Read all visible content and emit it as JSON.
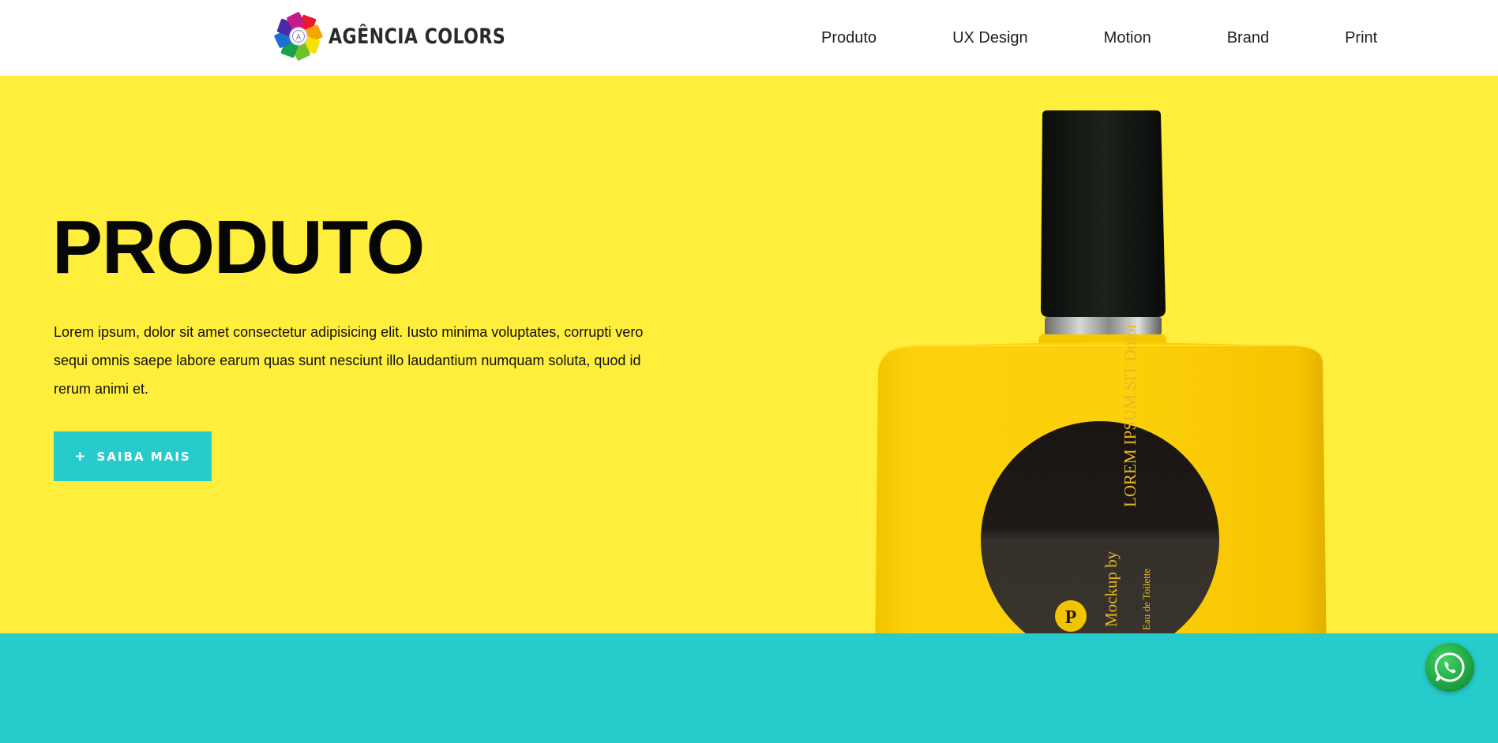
{
  "header": {
    "logo_text": "AGÊNCIA COLORS",
    "nav": [
      {
        "label": "Produto"
      },
      {
        "label": "UX Design"
      },
      {
        "label": "Motion"
      },
      {
        "label": "Brand"
      },
      {
        "label": "Print"
      }
    ]
  },
  "hero": {
    "title": "PRODUTO",
    "text": "Lorem ipsum, dolor sit amet consectetur adipisicing elit. Iusto minima voluptates, corrupti vero sequi omnis saepe labore earum quas sunt nesciunt illo laudantium numquam soluta, quod id rerum animi et.",
    "cta_icon": "+",
    "cta_label": "SAIBA MAIS",
    "product_label": {
      "line1": "LOREM IPSUM SIT Dolor",
      "line2": "Mockup by",
      "line3": "Eau de Toilette",
      "badge": "P"
    }
  },
  "floating": {
    "whatsapp_icon": "whatsapp-icon"
  },
  "colors": {
    "hero_bg": "#ffee3c",
    "accent_teal": "#26cccc",
    "bottle_yellow": "#fbcf0a",
    "bottle_cap": "#121712",
    "label_dark": "#2a2522",
    "label_text": "#e8b923"
  }
}
